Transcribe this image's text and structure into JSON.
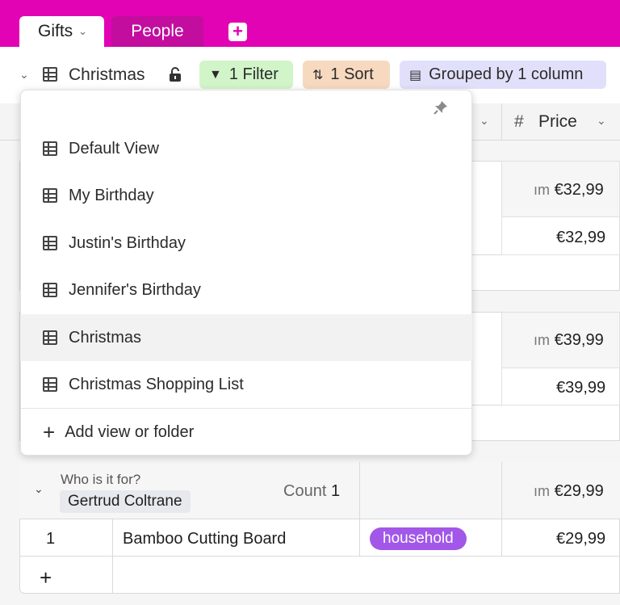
{
  "tabs": [
    {
      "label": "Gifts",
      "active": true
    },
    {
      "label": "People",
      "active": false
    }
  ],
  "add_tab": "+",
  "viewbar": {
    "view_name": "Christmas",
    "filter_label": "1 Filter",
    "sort_label": "1 Sort",
    "group_label": "Grouped by 1 column"
  },
  "columns": {
    "price_header": "Price"
  },
  "dropdown": {
    "views": [
      {
        "label": "Default View"
      },
      {
        "label": "My Birthday"
      },
      {
        "label": "Justin's Birthday"
      },
      {
        "label": "Jennifer's Birthday"
      },
      {
        "label": "Christmas",
        "active": true
      },
      {
        "label": "Christmas Shopping List"
      }
    ],
    "add_label": "Add view or folder"
  },
  "groups": [
    {
      "sum_prefix": "ım",
      "sum": "€32,99",
      "row_price": "€32,99"
    },
    {
      "sum_prefix": "ım",
      "sum": "€39,99",
      "row_price": "€39,99"
    },
    {
      "field_label": "Who is it for?",
      "value": "Gertrud Coltrane",
      "count_label": "Count",
      "count": "1",
      "sum_prefix": "ım",
      "sum": "€29,99",
      "rows": [
        {
          "index": "1",
          "name": "Bamboo Cutting Board",
          "tag": "household",
          "price": "€29,99"
        }
      ],
      "add_row": "+"
    }
  ],
  "colors": {
    "brand": "#e203b4",
    "filter_chip": "#d1f5c9",
    "sort_chip": "#f7d9c0",
    "group_chip": "#e1e0fb",
    "tag": "#a257e8"
  }
}
